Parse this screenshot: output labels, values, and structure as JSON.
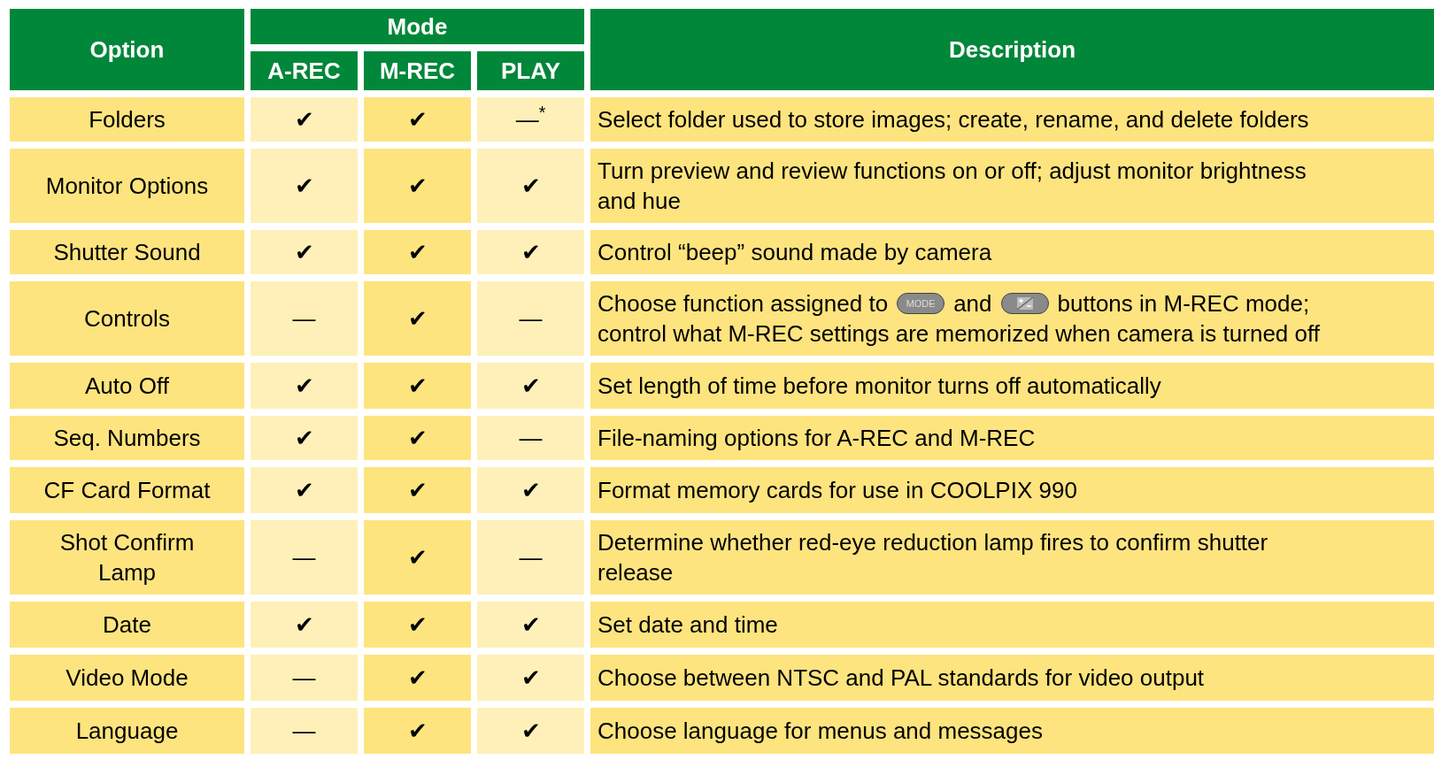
{
  "table": {
    "columns": {
      "option": "Option",
      "mode": "Mode",
      "modes": [
        "A-REC",
        "M-REC",
        "PLAY"
      ],
      "description": "Description"
    },
    "rows": [
      {
        "option": "Folders",
        "marks": [
          "✔",
          "✔",
          "—$^{*}$"
        ],
        "description": [
          [
            {
              "kind": "text",
              "text": "Select folder used to store images; create, rename, and delete folders"
            }
          ]
        ]
      },
      {
        "option": "Monitor Options",
        "marks": [
          "✔",
          "✔",
          "✔"
        ],
        "description": [
          [
            {
              "kind": "text",
              "text": "Turn preview and review functions on or off; adjust monitor brightness"
            }
          ],
          [
            {
              "kind": "text",
              "text": "and hue"
            }
          ]
        ]
      },
      {
        "option": "Shutter Sound",
        "marks": [
          "✔",
          "✔",
          "✔"
        ],
        "description": [
          [
            {
              "kind": "text",
              "text": "Control “beep” sound made by camera"
            }
          ]
        ]
      },
      {
        "option": "Controls",
        "marks": [
          "—",
          "✔",
          "—"
        ],
        "description": [
          [
            {
              "kind": "text",
              "text": "Choose function assigned to"
            },
            {
              "kind": "mode-button",
              "text": "MODE"
            },
            {
              "kind": "text",
              "text": "and"
            },
            {
              "kind": "exposure-button"
            },
            {
              "kind": "text",
              "text": "buttons in M-REC mode;"
            }
          ],
          [
            {
              "kind": "text",
              "text": "control what M-REC settings are memorized when camera is turned off"
            }
          ]
        ]
      },
      {
        "option": "Auto Off",
        "marks": [
          "✔",
          "✔",
          "✔"
        ],
        "description": [
          [
            {
              "kind": "text",
              "text": "Set length of time before monitor turns off automatically"
            }
          ]
        ]
      },
      {
        "option": "Seq. Numbers",
        "marks": [
          "✔",
          "✔",
          "—"
        ],
        "description": [
          [
            {
              "kind": "text",
              "text": "File-naming options for A-REC and M-REC"
            }
          ]
        ]
      },
      {
        "option": "CF Card Format",
        "marks": [
          "✔",
          "✔",
          "✔"
        ],
        "description": [
          [
            {
              "kind": "text",
              "text": "Format memory cards for use in COOLPIX 990"
            }
          ]
        ]
      },
      {
        "option": "Shot Confirm Lamp",
        "marks": [
          "—",
          "✔",
          "—"
        ],
        "description": [
          [
            {
              "kind": "text",
              "text": "Determine whether red-eye reduction lamp fires to confirm shutter"
            }
          ],
          [
            {
              "kind": "text",
              "text": "release"
            }
          ]
        ]
      },
      {
        "option": "Date",
        "marks": [
          "✔",
          "✔",
          "✔"
        ],
        "description": [
          [
            {
              "kind": "text",
              "text": "Set date and time"
            }
          ]
        ]
      },
      {
        "option": "Video Mode",
        "marks": [
          "—",
          "✔",
          "✔"
        ],
        "description": [
          [
            {
              "kind": "text",
              "text": "Choose between NTSC and PAL standards for video output"
            }
          ]
        ]
      },
      {
        "option": "Language",
        "marks": [
          "—",
          "✔",
          "✔"
        ],
        "description": [
          [
            {
              "kind": "text",
              "text": "Choose language for menus and messages"
            }
          ]
        ]
      }
    ]
  }
}
